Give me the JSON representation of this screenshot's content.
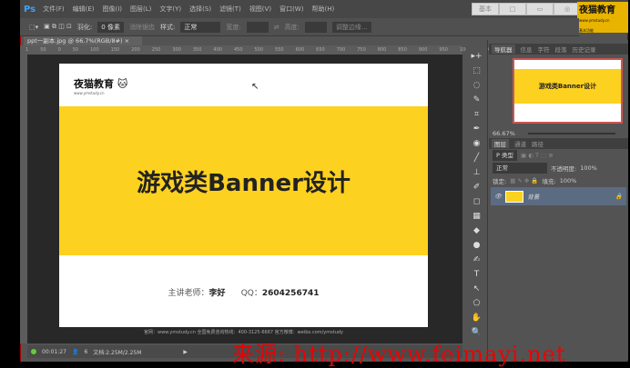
{
  "app": {
    "logo": "Ps"
  },
  "menu": [
    "文件(F)",
    "编辑(E)",
    "图像(I)",
    "图层(L)",
    "文字(Y)",
    "选择(S)",
    "滤镜(T)",
    "视图(V)",
    "窗口(W)",
    "帮助(H)"
  ],
  "window_buttons": [
    "基本",
    "□",
    "▭",
    "◎"
  ],
  "brand_logo": {
    "name": "夜猫教育",
    "url": "www.ymstudy.cn",
    "caption": "基本功能"
  },
  "options": {
    "feather_label": "羽化:",
    "feather_value": "0 像素",
    "antialias": "消除锯齿",
    "style_label": "样式:",
    "style_value": "正常",
    "width_label": "宽度:",
    "height_label": "高度:",
    "refine": "调整边缘..."
  },
  "document_tab": "ppt一副本.jpg @ 66.7%(RGB/8#)",
  "ruler_ticks": [
    "1",
    "50",
    "0",
    "50",
    "100",
    "150",
    "200",
    "250",
    "300",
    "350",
    "400",
    "450",
    "500",
    "550",
    "600",
    "650",
    "700",
    "750",
    "800",
    "850",
    "900",
    "950",
    "1000",
    "1050"
  ],
  "document": {
    "logo": "夜猫教育",
    "logo_url": "www.ymstudy.cn",
    "title": "游戏类Banner设计",
    "teacher_label": "主讲老师：",
    "teacher": "李好",
    "qq_label": "QQ：",
    "qq": "2604256741",
    "footer": "官网：www.ymstudy.cn    全国免费咨询热线：400-3125-6667    官方微博：weibo.com/ymstudy"
  },
  "status": {
    "time": "00:01:27",
    "users": "6",
    "doc_size": "文档:2.25M/2.25M"
  },
  "tools": [
    "▸+",
    "⬚",
    "◌",
    "✎",
    "⌗",
    "✒",
    "◉",
    "╱",
    "⊥",
    "✐",
    "◻",
    "▦",
    "◆",
    "●",
    "✍",
    "T",
    "↖",
    "⬠",
    "✋",
    "🔍"
  ],
  "navigator": {
    "tabs": [
      "导航器",
      "信息",
      "字符",
      "段落",
      "历史记录"
    ],
    "zoom": "66.67%",
    "thumb_title": "游戏类Banner设计"
  },
  "layers": {
    "tabs": [
      "图层",
      "通道",
      "路径"
    ],
    "filter": "P 类型",
    "blend": "正常",
    "opacity_label": "不透明度:",
    "opacity": "100%",
    "lock_label": "锁定:",
    "fill_label": "填充:",
    "fill": "100%",
    "items": [
      {
        "name": "背景"
      }
    ]
  },
  "watermark": "来源: http://www.feimayi.net",
  "colors": {
    "banner_yellow": "#fdd11f",
    "ps_blue": "#3fa0ff",
    "watermark_red": "#e00000"
  }
}
